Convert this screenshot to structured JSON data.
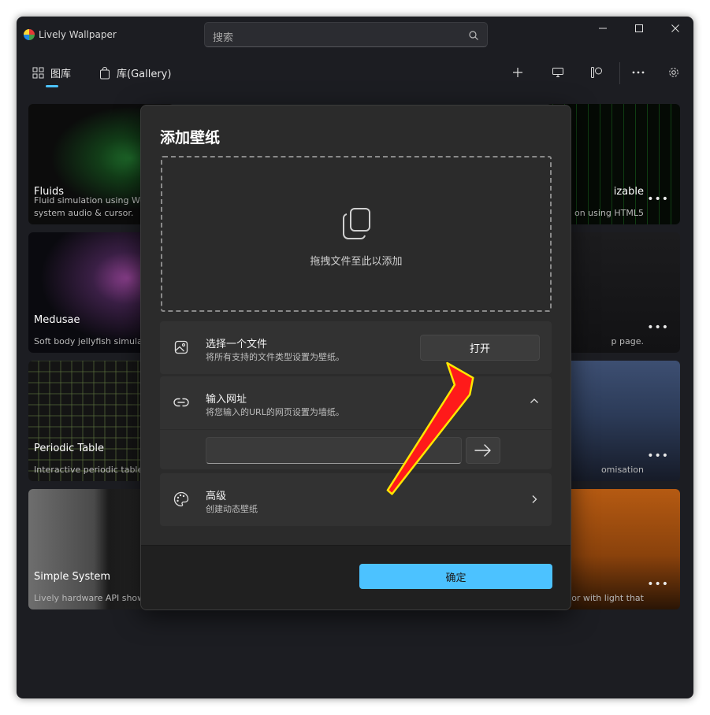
{
  "app": {
    "title": "Lively Wallpaper",
    "search_placeholder": "搜索"
  },
  "window_controls": {
    "minimize_icon": "minimize-icon",
    "maximize_icon": "maximize-icon",
    "close_icon": "close-icon"
  },
  "nav": {
    "library_label": "图库",
    "gallery_label": "库(Gallery)",
    "actions": [
      "add-icon",
      "monitor-icon",
      "layout-icon",
      "more-icon",
      "settings-icon"
    ]
  },
  "wallpapers": [
    {
      "title": "Fluids",
      "desc_line1": "Fluid simulation using We",
      "desc_line2": "system audio & cursor."
    },
    {
      "title": "Medusae",
      "desc_line1": "Soft body jellyfish simulat",
      "desc_line2": ""
    },
    {
      "title": "Periodic Table",
      "desc_line1": "Interactive periodic table",
      "desc_line2": ""
    },
    {
      "title": "Simple System",
      "desc_line1": "Lively hardware API show",
      "desc_line2": ""
    },
    {
      "title": "izable",
      "desc_line1": "on using HTML5",
      "desc_line2": ""
    },
    {
      "title": "",
      "desc_line1": "p page.",
      "desc_line2": ""
    },
    {
      "title": "",
      "desc_line1": "omisation",
      "desc_line2": ""
    },
    {
      "title": "",
      "desc_line1": "tor with light that",
      "desc_line2": ""
    }
  ],
  "card_more": "•••",
  "dialog": {
    "title": "添加壁纸",
    "drop_text": "拖拽文件至此以添加",
    "choose_file": {
      "title": "选择一个文件",
      "subtitle": "将所有支持的文件类型设置为壁纸。",
      "button": "打开"
    },
    "url": {
      "title": "输入网址",
      "subtitle": "将您输入的URL的网页设置为墙纸。",
      "input_value": ""
    },
    "advanced": {
      "title": "高级",
      "subtitle": "创建动态壁纸"
    },
    "ok_button": "确定"
  },
  "colors": {
    "accent": "#4cc2ff",
    "annotation_arrow": "#ff1a1a",
    "annotation_arrow_outline": "#ffe600"
  }
}
